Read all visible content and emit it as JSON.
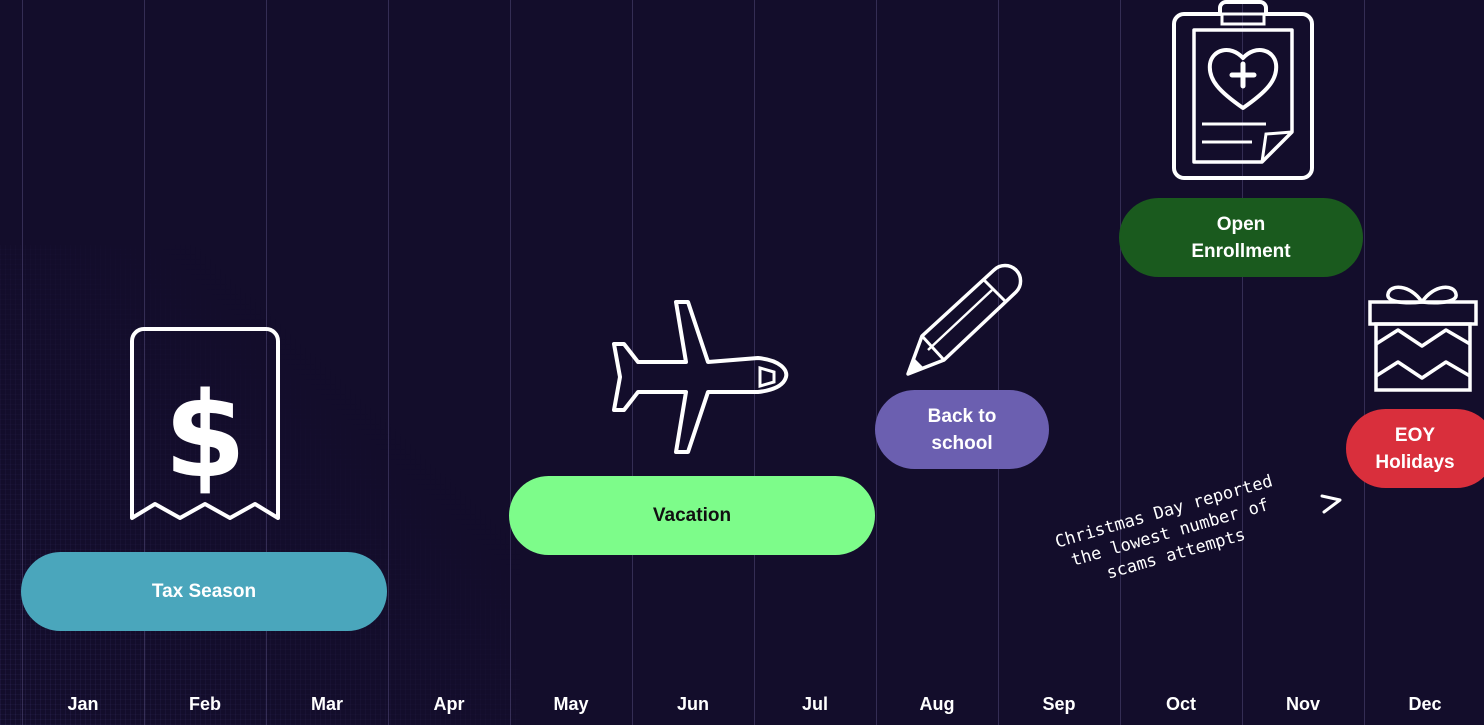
{
  "months": [
    "Jan",
    "Feb",
    "Mar",
    "Apr",
    "May",
    "Jun",
    "Jul",
    "Aug",
    "Sep",
    "Oct",
    "Nov",
    "Dec"
  ],
  "events": {
    "tax": {
      "label": "Tax Season",
      "color": "#4aa6bc",
      "icon": "receipt-dollar-icon"
    },
    "vacation": {
      "label": "Vacation",
      "color": "#7dfc8a",
      "icon": "airplane-icon"
    },
    "school": {
      "label_line1": "Back to",
      "label_line2": "school",
      "color": "#6b5fb0",
      "icon": "pencil-icon"
    },
    "enrollment": {
      "label_line1": "Open",
      "label_line2": "Enrollment",
      "color": "#1a5a1e",
      "icon": "medical-clipboard-icon"
    },
    "holidays": {
      "label_line1": "EOY",
      "label_line2": "Holidays",
      "color": "#d92f3c",
      "icon": "gift-box-icon"
    }
  },
  "annotation": {
    "line1": "Christmas Day reported",
    "line2": "the lowest number of",
    "line3": "scams attempts"
  }
}
